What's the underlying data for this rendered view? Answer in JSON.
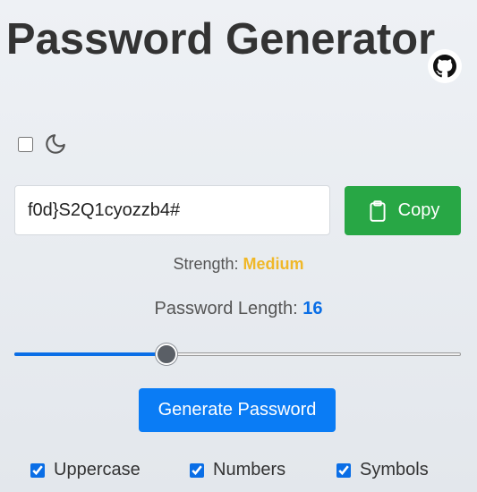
{
  "app": {
    "title": "Password Generator"
  },
  "header": {
    "github_icon": "github-icon"
  },
  "theme": {
    "dark_mode_checked": false,
    "icon": "moon-icon"
  },
  "password": {
    "value": "f0d}S2Q1cyozzb4#"
  },
  "copy": {
    "label": "Copy",
    "icon": "clipboard-icon",
    "color": "#28a745"
  },
  "strength": {
    "label": "Strength:",
    "value": "Medium",
    "color": "#f0b828"
  },
  "length": {
    "label": "Password Length:",
    "value": "16",
    "fraction": 0.34
  },
  "generate": {
    "label": "Generate Password",
    "color": "#0a7cf5"
  },
  "options": [
    {
      "label": "Uppercase",
      "checked": true
    },
    {
      "label": "Numbers",
      "checked": true
    },
    {
      "label": "Symbols",
      "checked": true
    }
  ]
}
